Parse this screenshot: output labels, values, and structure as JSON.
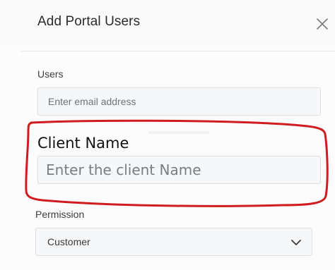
{
  "dialog": {
    "title": "Add Portal Users"
  },
  "users": {
    "label": "Users",
    "placeholder": "Enter email address",
    "value": ""
  },
  "client_name": {
    "label": "Client Name",
    "placeholder": "Enter the client Name",
    "value": ""
  },
  "permission": {
    "label": "Permission",
    "selected": "Customer"
  },
  "icons": {
    "close": "close-icon",
    "dropdown": "chevron-down-icon"
  },
  "colors": {
    "annotation": "#d01c1f",
    "input_bg": "#f6f7f9",
    "input_border": "#dcdfe4"
  }
}
